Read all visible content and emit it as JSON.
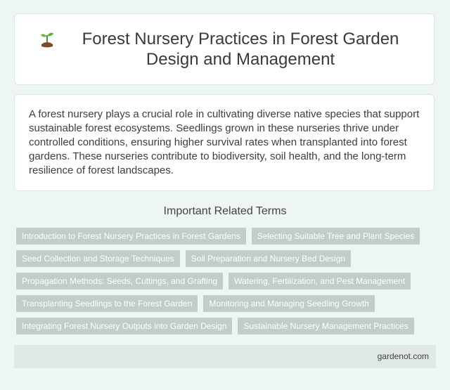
{
  "header": {
    "icon": "sprout-icon",
    "title": "Forest Nursery Practices in Forest Garden Design and Management"
  },
  "description": "A forest nursery plays a crucial role in cultivating diverse native species that support sustainable forest ecosystems. Seedlings grown in these nurseries thrive under controlled conditions, ensuring higher survival rates when transplanted into forest gardens. These nurseries contribute to biodiversity, soil health, and the long-term resilience of forest landscapes.",
  "related": {
    "heading": "Important Related Terms",
    "tags": [
      [
        "Introduction to Forest Nursery Practices in Forest Gardens",
        "Selecting Suitable Tree and Plant Species"
      ],
      [
        "Seed Collection and Storage Techniques",
        "Soil Preparation and Nursery Bed Design"
      ],
      [
        "Propagation Methods: Seeds, Cuttings, and Grafting",
        "Watering, Fertilization, and Pest Management"
      ],
      [
        "Transplanting Seedlings to the Forest Garden",
        "Monitoring and Managing Seedling Growth"
      ],
      [
        "Integrating Forest Nursery Outputs into Garden Design",
        "Sustainable Nursery Management Practices"
      ]
    ]
  },
  "footer": {
    "site": "gardenot.com"
  },
  "colors": {
    "background": "#eef6f2",
    "tag": "#c2cdc8",
    "footer": "#dfe8e3"
  }
}
